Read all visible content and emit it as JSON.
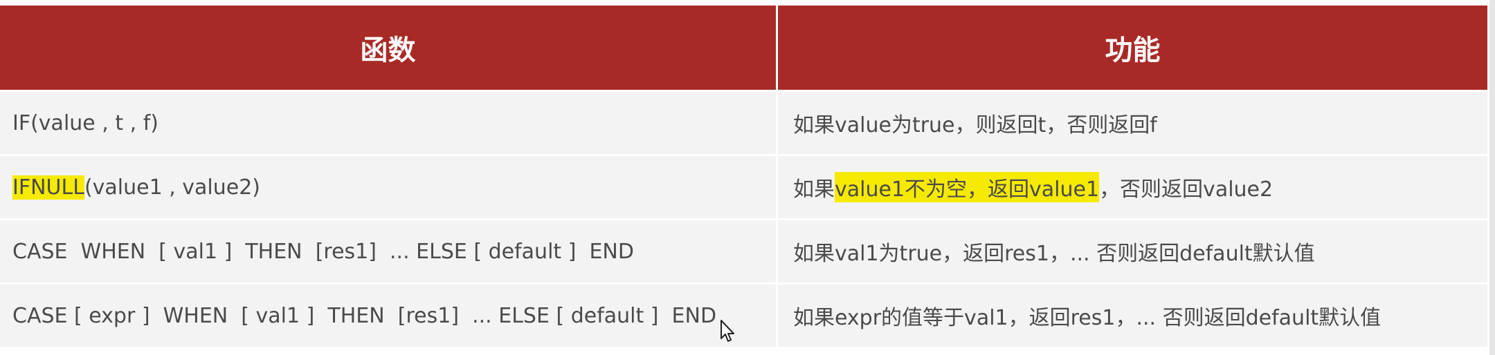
{
  "header": {
    "col1": "函数",
    "col2": "功能"
  },
  "rows": [
    {
      "func_pre": "",
      "func_hl": "",
      "func_post": "IF(value , t , f)",
      "desc_pre": "如果value为true，则返回t，否则返回f",
      "desc_hl": "",
      "desc_post": ""
    },
    {
      "func_pre": "",
      "func_hl": "IFNULL",
      "func_post": "(value1 , value2)",
      "desc_pre": "如果",
      "desc_hl": "value1不为空，返回value1",
      "desc_post": "，否则返回value2"
    },
    {
      "func_pre": "",
      "func_hl": "",
      "func_post": "CASE  WHEN  [ val1 ]  THEN  [res1]  ... ELSE [ default ]  END",
      "desc_pre": "如果val1为true，返回res1，... 否则返回default默认值",
      "desc_hl": "",
      "desc_post": ""
    },
    {
      "func_pre": "",
      "func_hl": "",
      "func_post": "CASE [ expr ]  WHEN  [ val1 ]  THEN  [res1]  ... ELSE [ default ]  END",
      "desc_pre": "如果expr的值等于val1，返回res1，... 否则返回default默认值",
      "desc_hl": "",
      "desc_post": ""
    }
  ],
  "colors": {
    "header_bg": "#a82a26",
    "row_bg": "#f3f3f3",
    "highlight": "#f5ea00"
  },
  "icons": {
    "cursor": "mouse-pointer-icon"
  }
}
